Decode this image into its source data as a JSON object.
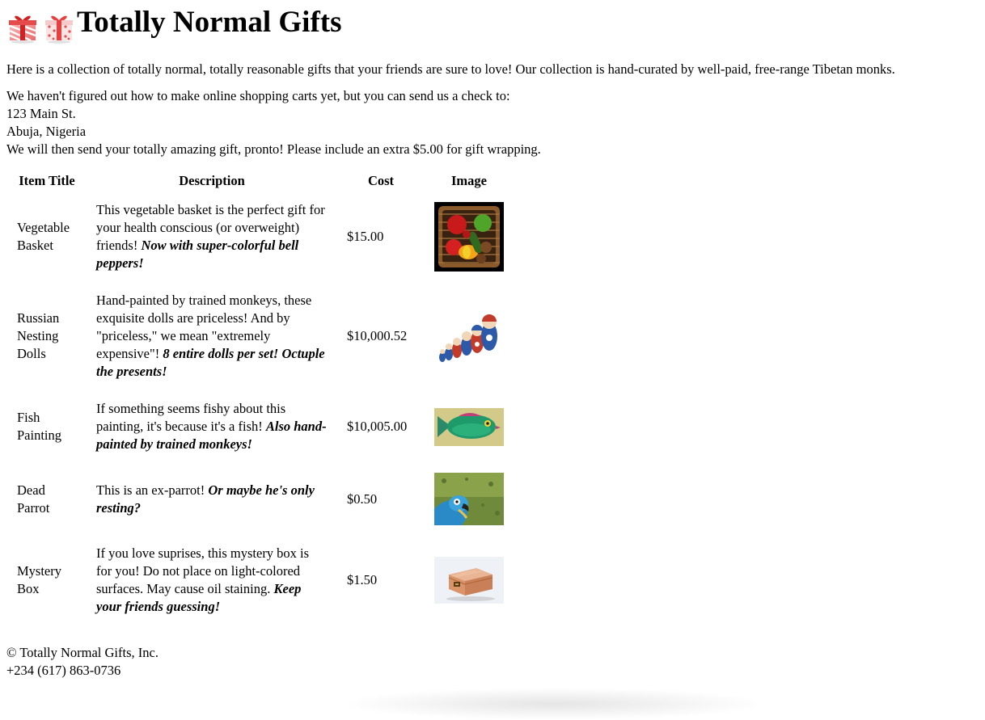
{
  "header": {
    "title": "Totally Normal Gifts",
    "icons": [
      "gift-icon",
      "gift-icon"
    ]
  },
  "intro": "Here is a collection of totally normal, totally reasonable gifts that your friends are sure to love! Our collection is hand-curated by well-paid, free-range Tibetan monks.",
  "address": {
    "line1": "We haven't figured out how to make online shopping carts yet, but you can send us a check to:",
    "street": "123 Main St.",
    "city": "Abuja, Nigeria",
    "line4": "We will then send your totally amazing gift, pronto! Please include an extra $5.00 for gift wrapping."
  },
  "table": {
    "headers": {
      "title": "Item Title",
      "description": "Description",
      "cost": "Cost",
      "image": "Image"
    },
    "rows": [
      {
        "title": "Vegetable Basket",
        "desc": "This vegetable basket is the perfect gift for your health conscious (or overweight) friends! ",
        "desc_emph": "Now with super-colorful bell peppers!",
        "cost": "$15.00",
        "image": "vegetable-basket-image"
      },
      {
        "title": "Russian Nesting Dolls",
        "desc": "Hand-painted by trained monkeys, these exquisite dolls are priceless! And by \"priceless,\" we mean \"extremely expensive\"! ",
        "desc_emph": "8 entire dolls per set! Octuple the presents!",
        "cost": "$10,000.52",
        "image": "nesting-dolls-image"
      },
      {
        "title": "Fish Painting",
        "desc": "If something seems fishy about this painting, it's because it's a fish! ",
        "desc_emph": "Also hand-painted by trained monkeys!",
        "cost": "$10,005.00",
        "image": "fish-painting-image"
      },
      {
        "title": "Dead Parrot",
        "desc": "This is an ex-parrot! ",
        "desc_emph": "Or maybe he's only resting?",
        "cost": "$0.50",
        "image": "parrot-image"
      },
      {
        "title": "Mystery Box",
        "desc": "If you love suprises, this mystery box is for you! Do not place on light-colored surfaces. May cause oil staining. ",
        "desc_emph": "Keep your friends guessing!",
        "cost": "$1.50",
        "image": "mystery-box-image"
      }
    ]
  },
  "footer": {
    "copyright": "© Totally Normal Gifts, Inc.",
    "phone": "+234 (617) 863-0736"
  }
}
